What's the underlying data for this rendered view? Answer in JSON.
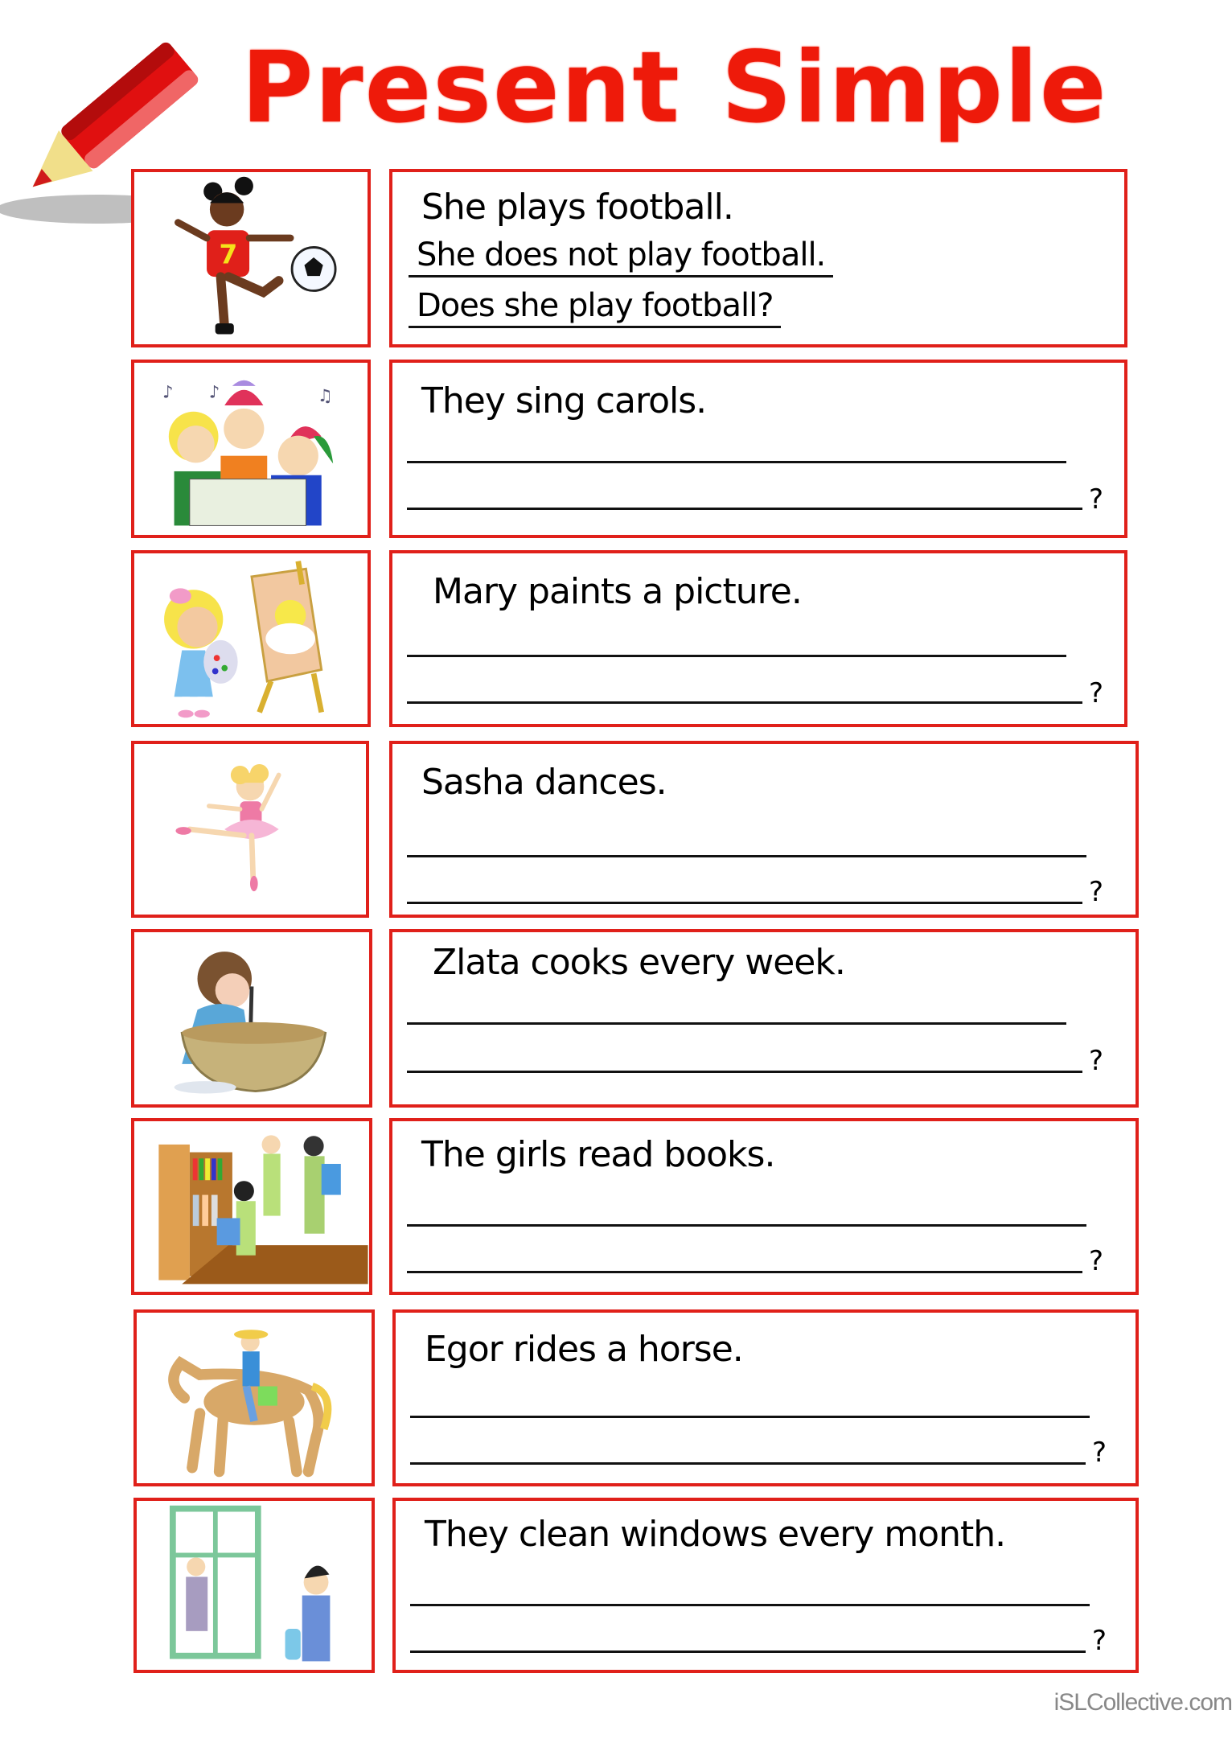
{
  "title": {
    "word1": "Present",
    "word2": "Simple"
  },
  "colors": {
    "title_red": "#ee1a0a",
    "border_red": "#e0201a"
  },
  "example": {
    "sentence": "She plays football.",
    "negative": "She does not play football.",
    "question": "Does she play football?",
    "picture": "girl-kicking-football"
  },
  "exercises": [
    {
      "sentence": "They sing carols.",
      "picture": "carol-singers",
      "question_mark": "?"
    },
    {
      "sentence": "Mary paints a picture.",
      "picture": "girl-painting-easel",
      "question_mark": "?"
    },
    {
      "sentence": "Sasha dances.",
      "picture": "ballerina",
      "question_mark": "?"
    },
    {
      "sentence": "Zlata cooks every week.",
      "picture": "girl-mixing-bowl",
      "question_mark": "?"
    },
    {
      "sentence": "The girls read books.",
      "picture": "girls-reading-books",
      "question_mark": "?"
    },
    {
      "sentence": "Egor rides a horse.",
      "picture": "cowboy-on-horse",
      "question_mark": "?"
    },
    {
      "sentence": "They clean windows every month.",
      "picture": "people-cleaning-window",
      "question_mark": "?"
    }
  ],
  "footer": {
    "watermark": "iSLCollective.com"
  }
}
